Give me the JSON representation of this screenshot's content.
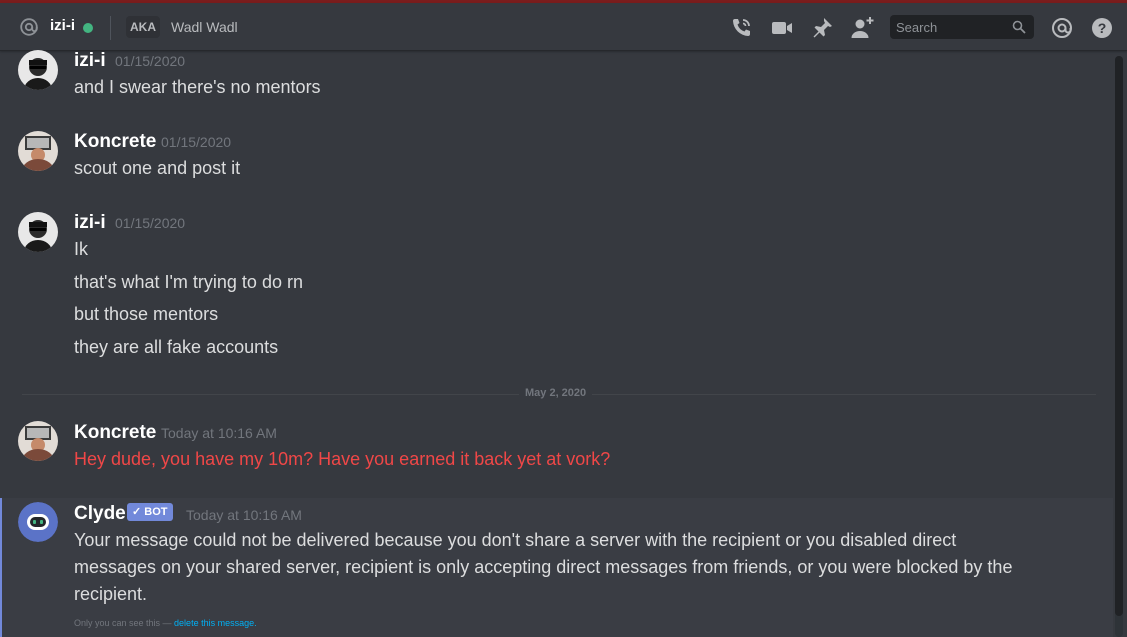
{
  "header": {
    "channel_name": "izi-i",
    "aka_label": "AKA",
    "nickname": "Wadl Wadl",
    "search_placeholder": "Search",
    "icons": [
      "at-icon",
      "call-icon",
      "video-icon",
      "pin-icon",
      "add-friend-icon",
      "search-icon",
      "mention-icon",
      "help-icon"
    ],
    "status_color": "#43b581"
  },
  "messages": [
    {
      "author": "izi-i",
      "timestamp": "01/15/2020",
      "lines": [
        "and I swear there's no mentors"
      ]
    },
    {
      "author": "Koncrete",
      "timestamp": "01/15/2020",
      "lines": [
        "scout one and post it"
      ]
    },
    {
      "author": "izi-i",
      "timestamp": "01/15/2020",
      "lines": [
        "Ik",
        "that's what I'm trying to do rn",
        "but those mentors",
        "they are all fake accounts"
      ]
    },
    {
      "author": "Koncrete",
      "timestamp": "Today at 10:16 AM",
      "lines": [
        "Hey dude, you have my 10m? Have you earned it back yet at vork?"
      ],
      "failed": true
    },
    {
      "author": "Clyde",
      "badge": "BOT",
      "timestamp": "Today at 10:16 AM",
      "lines": [
        "Your message could not be delivered because you don't share a server with the recipient or you disabled direct",
        "messages on your shared server, recipient is only accepting direct messages from friends, or you were blocked by the",
        "recipient."
      ],
      "note": "Only you can see this — ",
      "note_link": "delete this message."
    }
  ],
  "date_divider": "May 2, 2020",
  "colors": {
    "accent": "#7289da",
    "error": "#f04747",
    "link": "#00b0f4"
  }
}
